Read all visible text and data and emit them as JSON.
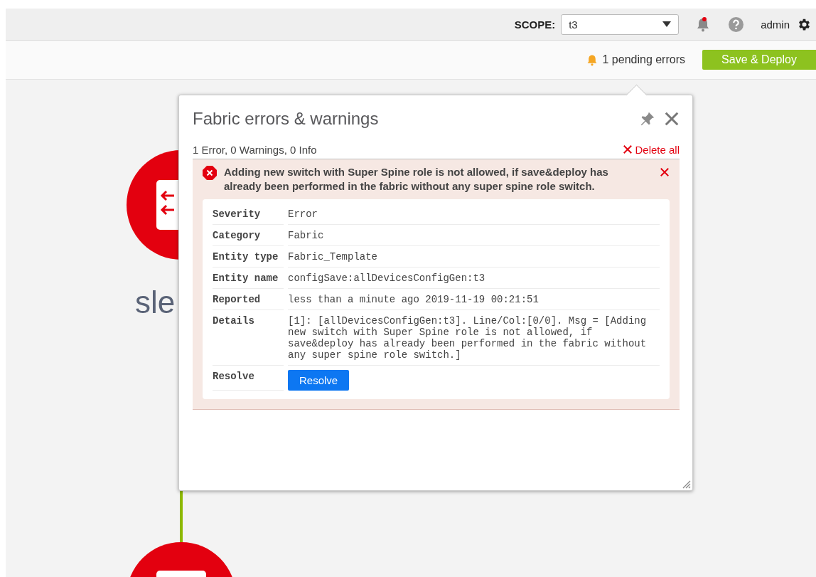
{
  "top_bar": {
    "scope_label": "SCOPE:",
    "scope_value": "t3",
    "notifications_unread": true,
    "user": "admin"
  },
  "action_bar": {
    "pending_errors": "1 pending errors",
    "save_button": "Save & Deploy"
  },
  "topology": {
    "node_label": "sle"
  },
  "errors_panel": {
    "title": "Fabric errors & warnings",
    "summary": "1 Error, 0 Warnings, 0 Info",
    "delete_all": "Delete all",
    "errors": [
      {
        "message": "Adding new switch with Super Spine role is not allowed, if save&deploy has already been performed in the fabric without any super spine role switch.",
        "details": [
          {
            "kind": "text",
            "label": "Severity",
            "value": "Error"
          },
          {
            "kind": "text",
            "label": "Category",
            "value": "Fabric"
          },
          {
            "kind": "text",
            "label": "Entity type",
            "value": "Fabric_Template"
          },
          {
            "kind": "text",
            "label": "Entity name",
            "value": "configSave:allDevicesConfigGen:t3"
          },
          {
            "kind": "text",
            "label": "Reported",
            "value": "less than a minute ago 2019-11-19 00:21:51"
          },
          {
            "kind": "text",
            "label": "Details",
            "value": "[1]: [allDevicesConfigGen:t3]. Line/Col:[0/0]. Msg = [Adding new switch with Super Spine role is not allowed, if save&deploy has already been performed in the fabric without any super spine role switch.]"
          },
          {
            "kind": "button",
            "label": "Resolve",
            "value": "Resolve"
          }
        ]
      }
    ]
  }
}
